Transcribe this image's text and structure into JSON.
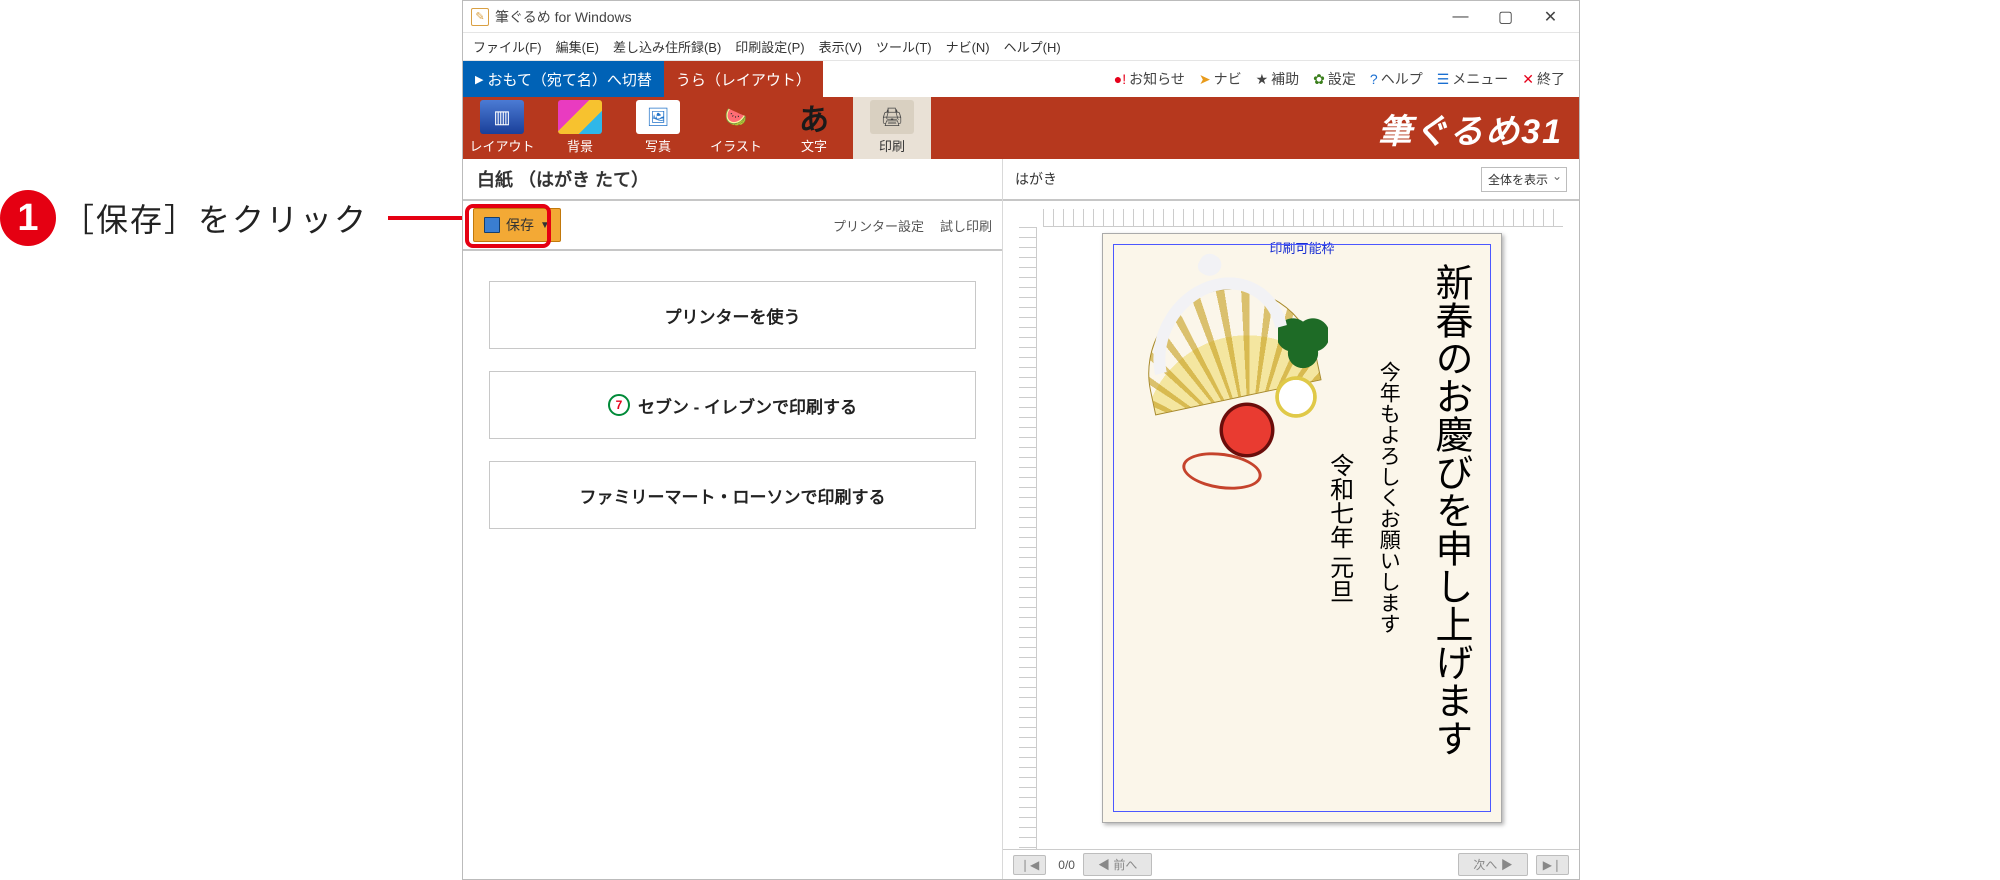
{
  "callout": {
    "step": "1",
    "text": "［保存］をクリック"
  },
  "window": {
    "title": "筆ぐるめ for Windows",
    "controls": {
      "minimize": "—",
      "maximize": "▢",
      "close": "✕"
    }
  },
  "menu": {
    "file": "ファイル(F)",
    "edit": "編集(E)",
    "address": "差し込み住所録(B)",
    "print_settings": "印刷設定(P)",
    "view": "表示(V)",
    "tool": "ツール(T)",
    "navi": "ナビ(N)",
    "help": "ヘルプ(H)"
  },
  "switch": {
    "omote": "おもて（宛て名）へ切替",
    "ura": "うら（レイアウト）"
  },
  "util": {
    "news": "お知らせ",
    "navi": "ナビ",
    "assist": "補助",
    "settings": "設定",
    "help": "ヘルプ",
    "menu": "メニュー",
    "exit": "終了"
  },
  "bigbar": {
    "layout": "レイアウト",
    "background": "背景",
    "photo": "写真",
    "illust": "イラスト",
    "text": "文字",
    "print": "印刷",
    "logo": "筆ぐるめ31"
  },
  "left": {
    "doc_title": "白紙 （はがき たて）",
    "save": "保存",
    "printer_settings": "プリンター設定",
    "test_print": "試し印刷",
    "options": {
      "use_printer": "プリンターを使う",
      "seven_eleven": "セブン - イレブンで印刷する",
      "fm_lawson": "ファミリーマート・ローソンで印刷する"
    }
  },
  "right": {
    "header": "はがき",
    "zoom": "全体を表示",
    "printable_area": "印刷可能枠",
    "card": {
      "greeting": "新春のお慶びを申し上げます",
      "body": "今年もよろしくお願いします",
      "date": "令和七年 元旦"
    },
    "nav": {
      "count": "0/0",
      "first": "❘◀",
      "prev": "◀ 前へ",
      "next": "次へ ▶",
      "last": "▶❘"
    }
  }
}
